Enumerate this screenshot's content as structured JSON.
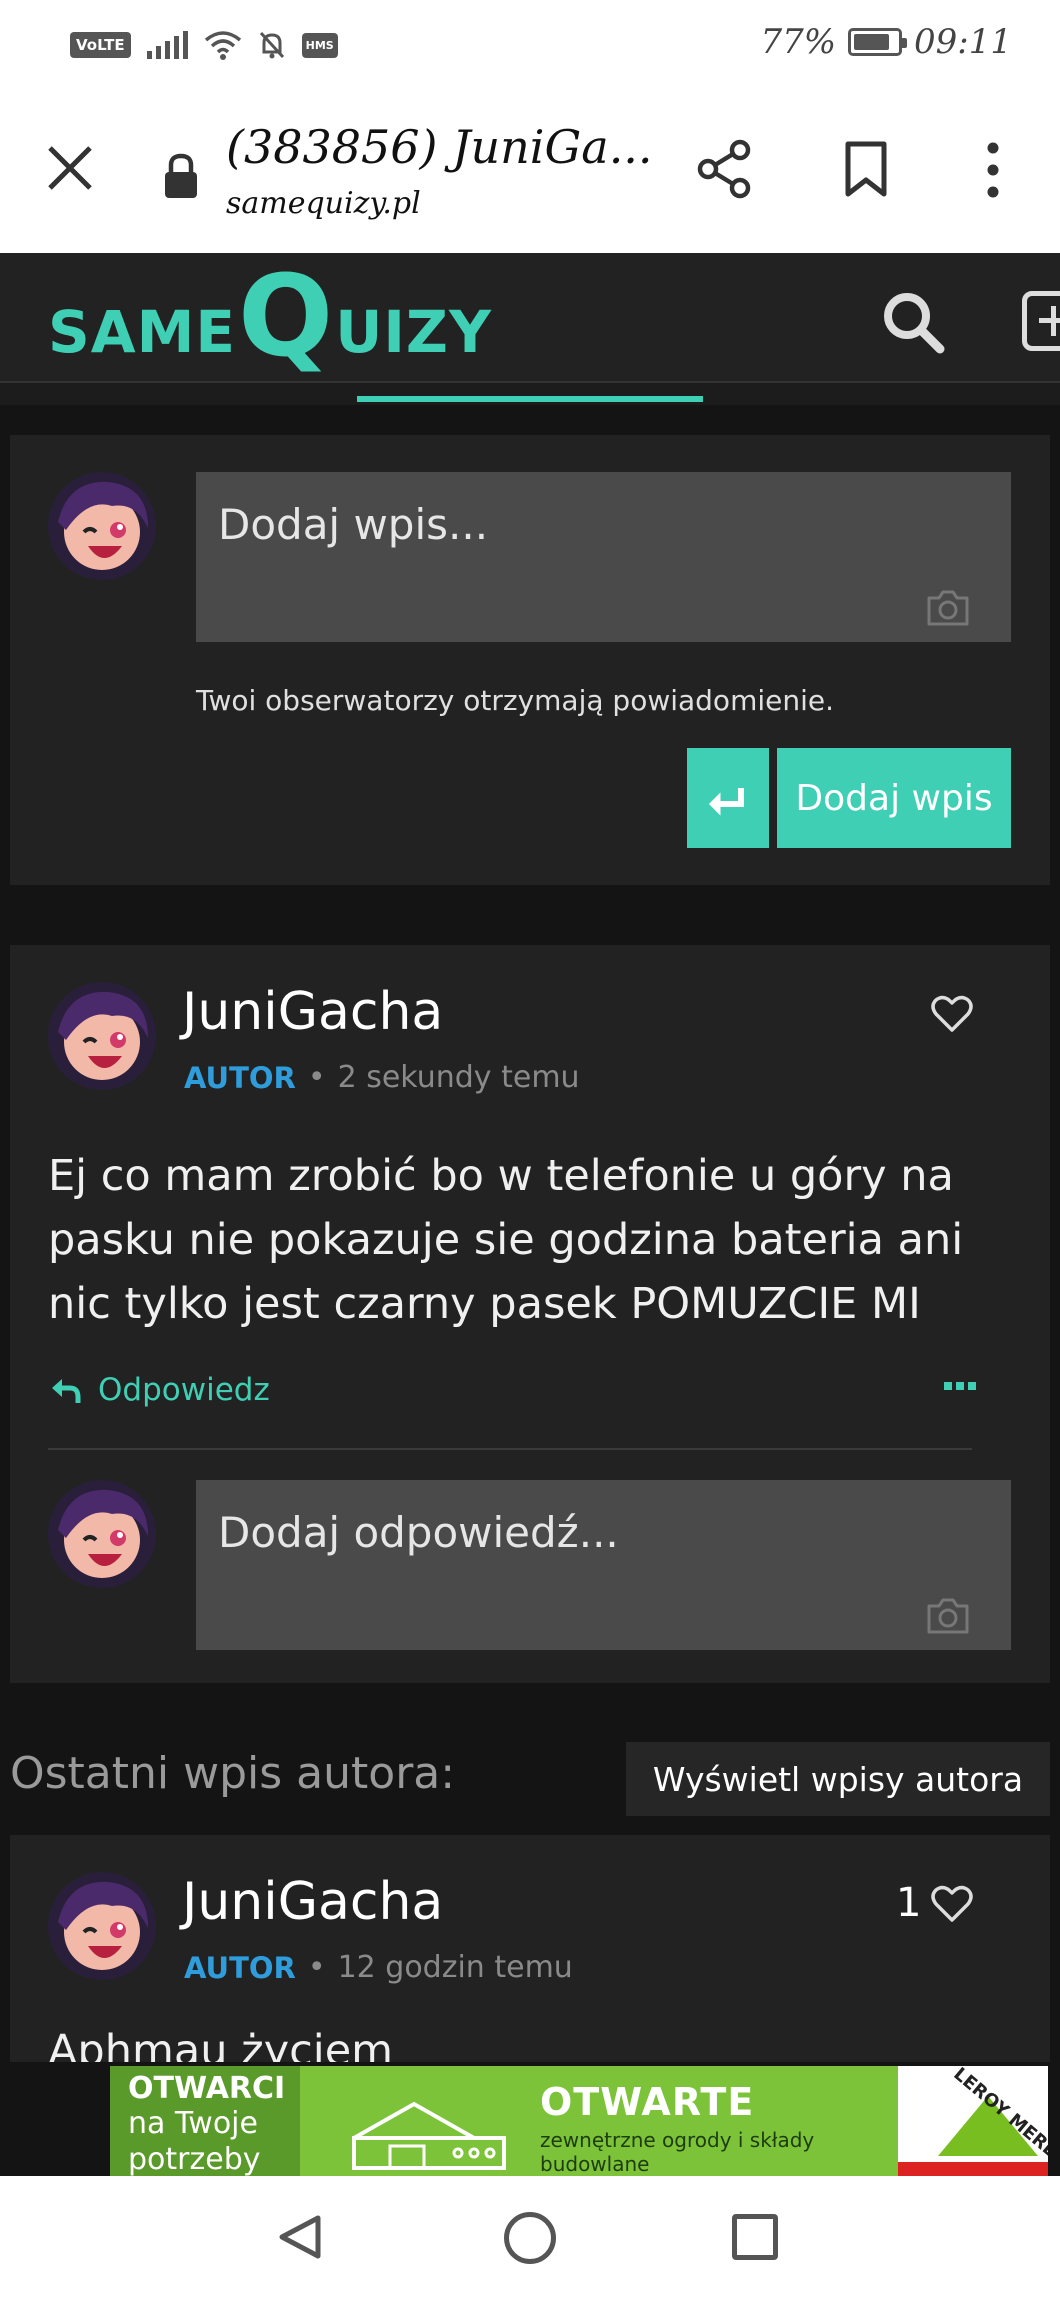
{
  "status_bar": {
    "volte": "VoLTE",
    "hms": "HMS",
    "battery": "77%",
    "time": "09:11"
  },
  "browser": {
    "title": "(383856) JuniGa...",
    "url": "samequizy.pl"
  },
  "site": {
    "logo_left": "SAME",
    "logo_q": "Q",
    "logo_right": "UIZY",
    "accent": "#3fcfb4"
  },
  "composer": {
    "placeholder": "Dodaj wpis...",
    "notice": "Twoi obserwatorzy otrzymają powiadomienie.",
    "submit_label": "Dodaj wpis"
  },
  "post": {
    "author": "JuniGacha",
    "badge": "AUTOR",
    "separator": "•",
    "time": "2 sekundy temu",
    "text": "Ej co mam zrobić bo w telefonie u góry na pasku nie pokazuje sie godzina bateria ani nic tylko jest czarny pasek POMUZCIE MI",
    "reply_label": "Odpowiedz",
    "reply_placeholder": "Dodaj odpowiedź..."
  },
  "latest": {
    "section_label": "Ostatni wpis autora:",
    "view_button": "Wyświetl wpisy autora",
    "author": "JuniGacha",
    "badge": "AUTOR",
    "separator": "•",
    "time": "12 godzin temu",
    "likes": "1",
    "text_cut": "Aphmau życiem"
  },
  "ad": {
    "left_line1": "OTWARCI",
    "left_line2": "na Twoje",
    "left_line3": "potrzeby",
    "headline": "OTWARTE",
    "sub1": "zewnętrzne ogrody i składy",
    "sub2": "budowlane",
    "brand": "LEROY MERLIN"
  },
  "icons": [
    "close-icon",
    "lock-icon",
    "share-icon",
    "bookmark-icon",
    "more-vert-icon",
    "search-icon",
    "add-icon",
    "camera-icon",
    "enter-icon",
    "heart-icon",
    "reply-icon",
    "more-horiz-icon",
    "back-icon",
    "home-icon",
    "recents-icon"
  ]
}
